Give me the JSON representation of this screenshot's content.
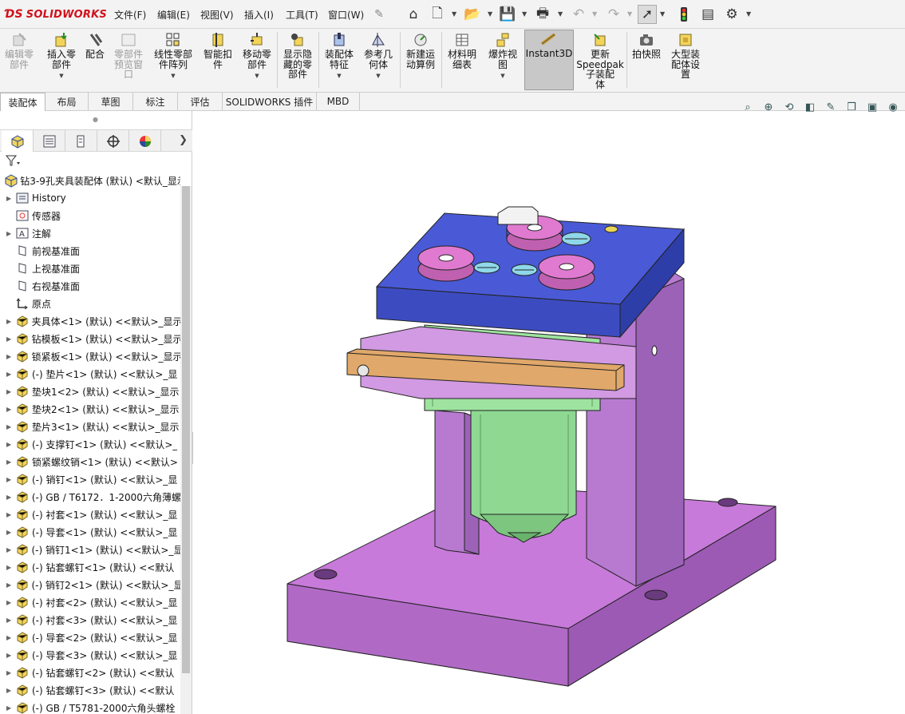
{
  "app": {
    "logo_text": "SOLIDWORKS",
    "brand_color": "#d0121b"
  },
  "menu": {
    "items": [
      "文件(F)",
      "编辑(E)",
      "视图(V)",
      "插入(I)",
      "工具(T)",
      "窗口(W)"
    ]
  },
  "quick_access": [
    "pin-icon",
    "home-icon",
    "new-icon",
    "open-icon",
    "save-icon",
    "print-icon",
    "undo-icon",
    "redo-icon",
    "select-icon",
    "traffic-light-icon",
    "file-properties-icon",
    "options-icon"
  ],
  "ribbon": {
    "buttons": [
      {
        "label": "编辑零\n部件",
        "icon": "edit-component-icon",
        "disabled": true
      },
      {
        "label": "插入零\n部件",
        "icon": "insert-component-icon"
      },
      {
        "label": "配合",
        "icon": "mate-icon"
      },
      {
        "label": "零部件\n预览窗\n口",
        "icon": "component-preview-icon",
        "disabled": true
      },
      {
        "label": "线性零部\n件阵列",
        "icon": "linear-pattern-icon"
      },
      {
        "label": "智能扣\n件",
        "icon": "smart-fasteners-icon"
      },
      {
        "label": "移动零\n部件",
        "icon": "move-component-icon"
      },
      {
        "label": "显示隐\n藏的零\n部件",
        "icon": "show-hidden-icon"
      },
      {
        "label": "装配体\n特征",
        "icon": "assembly-features-icon"
      },
      {
        "label": "参考几\n何体",
        "icon": "reference-geometry-icon"
      },
      {
        "label": "新建运\n动算例",
        "icon": "motion-study-icon"
      },
      {
        "label": "材料明\n细表",
        "icon": "bom-icon"
      },
      {
        "label": "爆炸视\n图",
        "icon": "exploded-view-icon"
      },
      {
        "label": "Instant3D",
        "icon": "instant3d-icon",
        "active": true
      },
      {
        "label": "更新\nSpeedpak\n子装配\n体",
        "icon": "speedpak-icon"
      },
      {
        "label": "拍快照",
        "icon": "snapshot-icon"
      },
      {
        "label": "大型装\n配体设\n置",
        "icon": "large-assembly-icon"
      }
    ]
  },
  "tabs": [
    "装配体",
    "布局",
    "草图",
    "标注",
    "评估",
    "SOLIDWORKS 插件",
    "MBD"
  ],
  "feature_manager": {
    "panel_tabs": [
      "featuremanager-icon",
      "propertymanager-icon",
      "configurationmanager-icon",
      "dimxpert-icon",
      "display-manager-icon"
    ],
    "root": "钻3-9孔夹具装配体 (默认) <默认_显示",
    "items": [
      {
        "label": "History",
        "icon": "history-icon",
        "expand": true
      },
      {
        "label": "传感器",
        "icon": "sensor-icon",
        "expand": false
      },
      {
        "label": "注解",
        "icon": "annotation-icon",
        "expand": true
      },
      {
        "label": "前视基准面",
        "icon": "plane-icon",
        "expand": false
      },
      {
        "label": "上视基准面",
        "icon": "plane-icon",
        "expand": false
      },
      {
        "label": "右视基准面",
        "icon": "plane-icon",
        "expand": false
      },
      {
        "label": "原点",
        "icon": "origin-icon",
        "expand": false
      },
      {
        "label": "夹具体<1> (默认) <<默认>_显示",
        "icon": "part-icon",
        "expand": true
      },
      {
        "label": "钻模板<1> (默认) <<默认>_显示",
        "icon": "part-icon",
        "expand": true
      },
      {
        "label": "锁紧板<1> (默认) <<默认>_显示",
        "icon": "part-icon",
        "expand": true
      },
      {
        "label": "(-) 垫片<1> (默认) <<默认>_显",
        "icon": "part-icon",
        "expand": true
      },
      {
        "label": "垫块1<2> (默认) <<默认>_显示",
        "icon": "part-icon",
        "expand": true
      },
      {
        "label": "垫块2<1> (默认) <<默认>_显示",
        "icon": "part-icon",
        "expand": true
      },
      {
        "label": "垫片3<1> (默认) <<默认>_显示",
        "icon": "part-icon",
        "expand": true
      },
      {
        "label": "(-) 支撑钉<1> (默认) <<默认>_",
        "icon": "part-icon",
        "expand": true
      },
      {
        "label": "锁紧螺纹销<1> (默认) <<默认>",
        "icon": "part-icon",
        "expand": true
      },
      {
        "label": "(-) 销钉<1> (默认) <<默认>_显",
        "icon": "part-icon",
        "expand": true
      },
      {
        "label": "(-) GB / T6172．1-2000六角薄螺",
        "icon": "part-icon",
        "expand": true
      },
      {
        "label": "(-) 衬套<1> (默认) <<默认>_显",
        "icon": "part-icon",
        "expand": true
      },
      {
        "label": "(-) 导套<1> (默认) <<默认>_显",
        "icon": "part-icon",
        "expand": true
      },
      {
        "label": "(-) 销钉1<1> (默认) <<默认>_显",
        "icon": "part-icon",
        "expand": true
      },
      {
        "label": "(-) 钻套螺钉<1> (默认) <<默认",
        "icon": "part-icon",
        "expand": true
      },
      {
        "label": "(-) 销钉2<1> (默认) <<默认>_显",
        "icon": "part-icon",
        "expand": true
      },
      {
        "label": "(-) 衬套<2> (默认) <<默认>_显",
        "icon": "part-icon",
        "expand": true
      },
      {
        "label": "(-) 衬套<3> (默认) <<默认>_显",
        "icon": "part-icon",
        "expand": true
      },
      {
        "label": "(-) 导套<2> (默认) <<默认>_显",
        "icon": "part-icon",
        "expand": true
      },
      {
        "label": "(-) 导套<3> (默认) <<默认>_显",
        "icon": "part-icon",
        "expand": true
      },
      {
        "label": "(-) 钻套螺钉<2> (默认) <<默认",
        "icon": "part-icon",
        "expand": true
      },
      {
        "label": "(-) 钻套螺钉<3> (默认) <<默认",
        "icon": "part-icon",
        "expand": true
      },
      {
        "label": "(-) GB / T5781-2000六角头螺栓",
        "icon": "part-icon",
        "expand": true
      }
    ]
  },
  "view_toolbar": [
    "zoom-to-fit-icon",
    "zoom-area-icon",
    "previous-view-icon",
    "section-view-icon",
    "dynamic-annotation-icon",
    "view-orientation-icon",
    "display-style-icon",
    "hide-show-icon"
  ],
  "colors": {
    "base_plate": "#c77ad9",
    "drill_plate": "#4a5ad6",
    "column": "#b87ad0",
    "body_green": "#9ee3a0",
    "bushing_pink": "#e07ad0",
    "screw_blue": "#8fd8ea",
    "bar_orange": "#e0a86a"
  }
}
